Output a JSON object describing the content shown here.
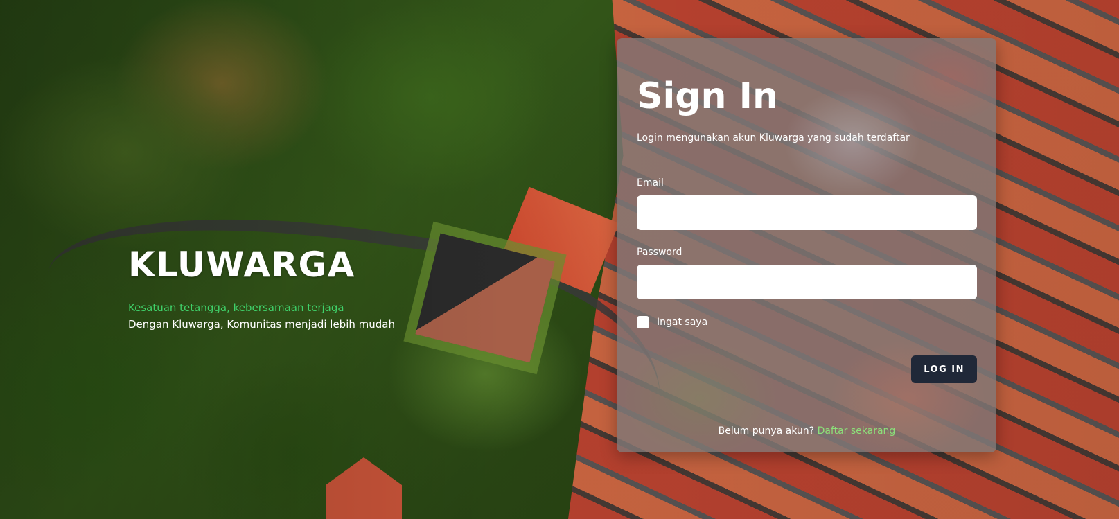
{
  "brand": {
    "title": "KLUWARGA",
    "tagline": "Kesatuan tetangga, kebersamaan terjaga",
    "description": "Dengan Kluwarga, Komunitas menjadi lebih mudah"
  },
  "signin": {
    "title": "Sign In",
    "subtitle": "Login mengunakan akun Kluwarga yang sudah terdaftar",
    "email_label": "Email",
    "email_value": "",
    "password_label": "Password",
    "password_value": "",
    "remember_label": "Ingat saya",
    "remember_checked": false,
    "login_label": "LOG IN",
    "register_prompt": "Belum punya akun?",
    "register_link": "Daftar sekarang"
  },
  "colors": {
    "accent_green": "#3fd16a",
    "link_green": "#8ce07a",
    "button_dark": "#202838"
  }
}
